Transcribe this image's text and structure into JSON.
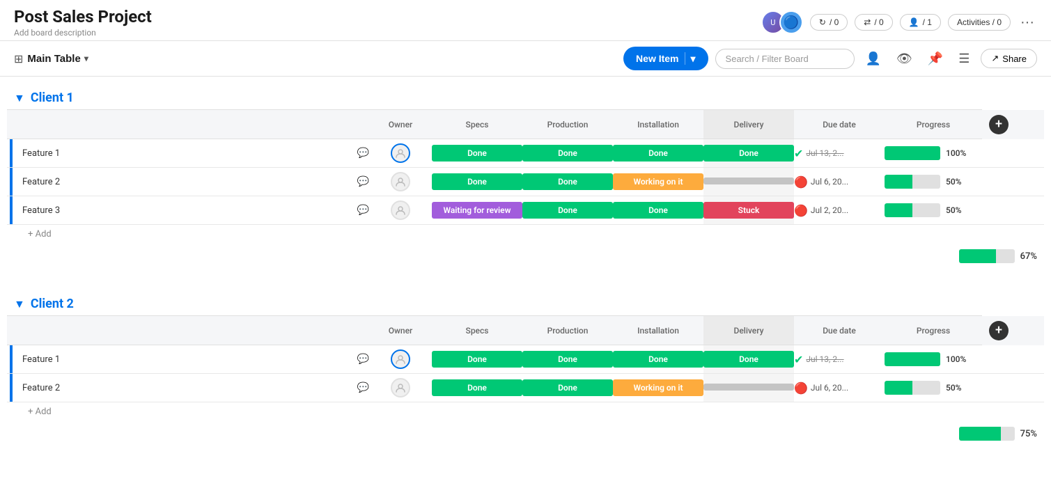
{
  "header": {
    "title": "Post Sales Project",
    "description": "Add board description",
    "stats": {
      "updates": "/ 0",
      "connections": "/ 0",
      "people": "/ 1",
      "activities": "Activities / 0"
    },
    "more_label": "···"
  },
  "toolbar": {
    "table_icon": "⊞",
    "main_table_label": "Main Table",
    "chevron": "∨",
    "new_item_label": "New Item",
    "search_placeholder": "Search / Filter Board",
    "share_label": "Share"
  },
  "groups": [
    {
      "id": "client1",
      "title": "Client 1",
      "columns": {
        "owner": "Owner",
        "specs": "Specs",
        "production": "Production",
        "installation": "Installation",
        "delivery": "Delivery",
        "due_date": "Due date",
        "progress": "Progress"
      },
      "rows": [
        {
          "name": "Feature 1",
          "specs": "Done",
          "specs_type": "done",
          "production": "Done",
          "production_type": "done",
          "installation": "Done",
          "installation_type": "done",
          "delivery": "Done",
          "delivery_type": "done",
          "due_date": "Jul 13, 2...",
          "due_icon": "check",
          "due_strikethrough": true,
          "progress": 100
        },
        {
          "name": "Feature 2",
          "specs": "Done",
          "specs_type": "done",
          "production": "Done",
          "production_type": "done",
          "installation": "Working on it",
          "installation_type": "working",
          "delivery": "",
          "delivery_type": "empty",
          "due_date": "Jul 6, 20...",
          "due_icon": "alert",
          "due_strikethrough": false,
          "progress": 50
        },
        {
          "name": "Feature 3",
          "specs": "Waiting for review",
          "specs_type": "review",
          "production": "Done",
          "production_type": "done",
          "installation": "Done",
          "installation_type": "done",
          "delivery": "Stuck",
          "delivery_type": "stuck",
          "due_date": "Jul 2, 20...",
          "due_icon": "alert",
          "due_strikethrough": false,
          "progress": 50
        }
      ],
      "add_label": "+ Add",
      "summary_progress": 67,
      "summary_pct": "67%"
    },
    {
      "id": "client2",
      "title": "Client 2",
      "columns": {
        "owner": "Owner",
        "specs": "Specs",
        "production": "Production",
        "installation": "Installation",
        "delivery": "Delivery",
        "due_date": "Due date",
        "progress": "Progress"
      },
      "rows": [
        {
          "name": "Feature 1",
          "specs": "Done",
          "specs_type": "done",
          "production": "Done",
          "production_type": "done",
          "installation": "Done",
          "installation_type": "done",
          "delivery": "Done",
          "delivery_type": "done",
          "due_date": "Jul 13, 2...",
          "due_icon": "check",
          "due_strikethrough": true,
          "progress": 100
        },
        {
          "name": "Feature 2",
          "specs": "Done",
          "specs_type": "done",
          "production": "Done",
          "production_type": "done",
          "installation": "Working on it",
          "installation_type": "working",
          "delivery": "",
          "delivery_type": "empty",
          "due_date": "Jul 6, 20...",
          "due_icon": "alert",
          "due_strikethrough": false,
          "progress": 50
        }
      ],
      "add_label": "+ Add",
      "summary_progress": 75,
      "summary_pct": "75%"
    }
  ],
  "colors": {
    "done": "#00c875",
    "working": "#fdab3d",
    "stuck": "#e2445c",
    "review": "#a25ddc",
    "empty": "#c4c4c4",
    "blue_accent": "#0073ea"
  }
}
